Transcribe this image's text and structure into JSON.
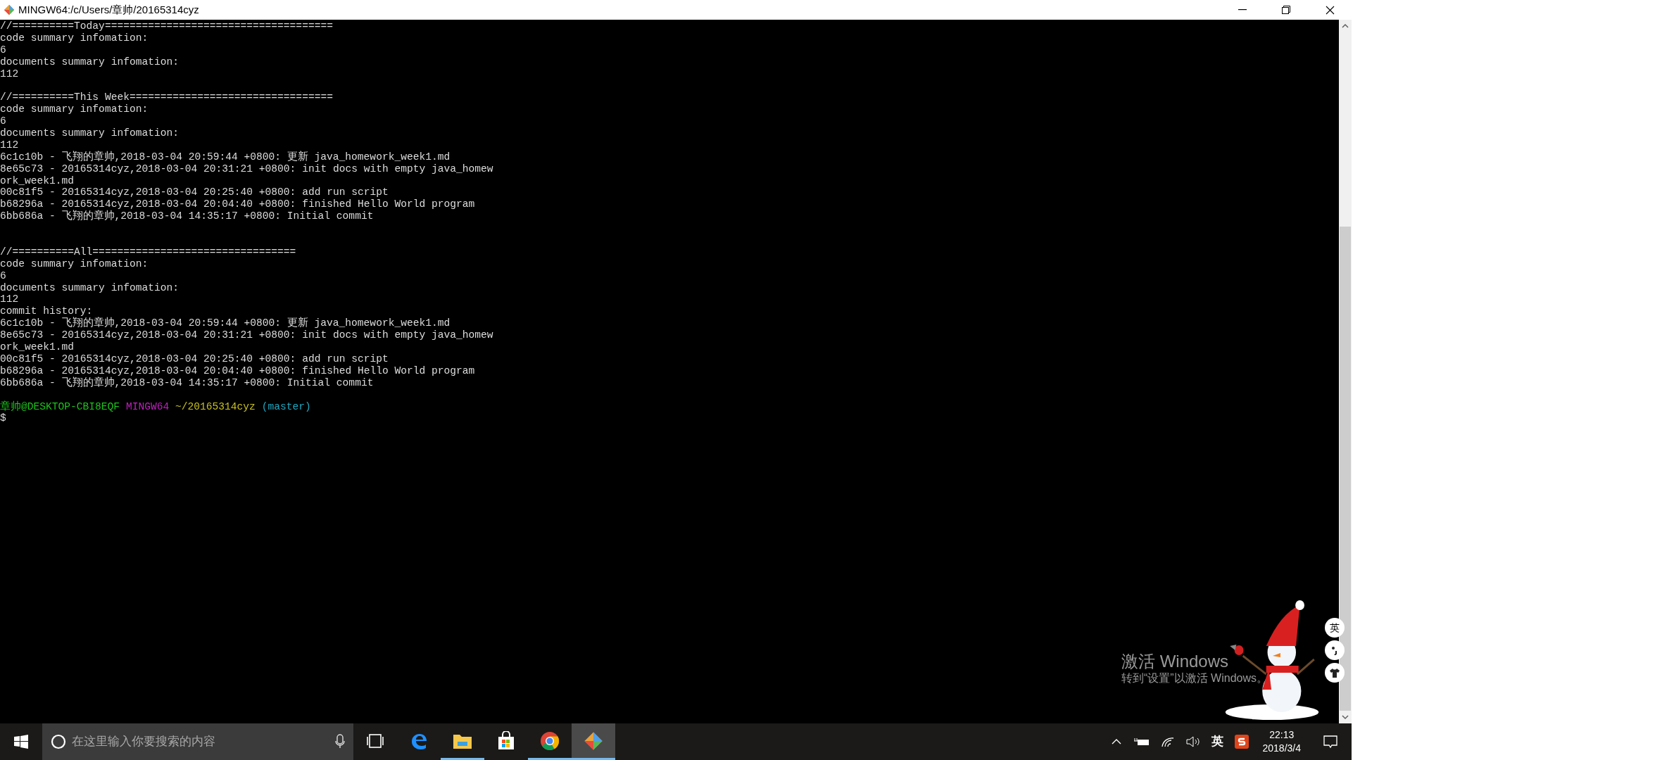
{
  "window": {
    "title": "MINGW64:/c/Users/章帅/20165314cyz"
  },
  "terminal": {
    "lines": [
      {
        "kind": "text",
        "text": "//==========Today====================================="
      },
      {
        "kind": "text",
        "text": "code summary infomation:"
      },
      {
        "kind": "text",
        "text": "6"
      },
      {
        "kind": "text",
        "text": "documents summary infomation:"
      },
      {
        "kind": "text",
        "text": "112"
      },
      {
        "kind": "blank"
      },
      {
        "kind": "text",
        "text": "//==========This Week================================="
      },
      {
        "kind": "text",
        "text": "code summary infomation:"
      },
      {
        "kind": "text",
        "text": "6"
      },
      {
        "kind": "text",
        "text": "documents summary infomation:"
      },
      {
        "kind": "text",
        "text": "112"
      },
      {
        "kind": "text",
        "text": "6c1c10b - 飞翔的章帅,2018-03-04 20:59:44 +0800: 更新 java_homework_week1.md"
      },
      {
        "kind": "text",
        "text": "8e65c73 - 20165314cyz,2018-03-04 20:31:21 +0800: init docs with empty java_homew"
      },
      {
        "kind": "text",
        "text": "ork_week1.md"
      },
      {
        "kind": "text",
        "text": "00c81f5 - 20165314cyz,2018-03-04 20:25:40 +0800: add run script"
      },
      {
        "kind": "text",
        "text": "b68296a - 20165314cyz,2018-03-04 20:04:40 +0800: finished Hello World program"
      },
      {
        "kind": "text",
        "text": "6bb686a - 飞翔的章帅,2018-03-04 14:35:17 +0800: Initial commit"
      },
      {
        "kind": "blank"
      },
      {
        "kind": "blank"
      },
      {
        "kind": "text",
        "text": "//==========All================================="
      },
      {
        "kind": "text",
        "text": "code summary infomation:"
      },
      {
        "kind": "text",
        "text": "6"
      },
      {
        "kind": "text",
        "text": "documents summary infomation:"
      },
      {
        "kind": "text",
        "text": "112"
      },
      {
        "kind": "text",
        "text": "commit history:"
      },
      {
        "kind": "text",
        "text": "6c1c10b - 飞翔的章帅,2018-03-04 20:59:44 +0800: 更新 java_homework_week1.md"
      },
      {
        "kind": "text",
        "text": "8e65c73 - 20165314cyz,2018-03-04 20:31:21 +0800: init docs with empty java_homew"
      },
      {
        "kind": "text",
        "text": "ork_week1.md"
      },
      {
        "kind": "text",
        "text": "00c81f5 - 20165314cyz,2018-03-04 20:25:40 +0800: add run script"
      },
      {
        "kind": "text",
        "text": "b68296a - 20165314cyz,2018-03-04 20:04:40 +0800: finished Hello World program"
      },
      {
        "kind": "text",
        "text": "6bb686a - 飞翔的章帅,2018-03-04 14:35:17 +0800: Initial commit"
      },
      {
        "kind": "blank"
      },
      {
        "kind": "prompt",
        "segments": [
          {
            "text": "章帅@DESKTOP-CBI8EQF",
            "color": "#1cc41c"
          },
          {
            "text": "MINGW64",
            "color": "#c020c0"
          },
          {
            "text": "~/20165314cyz",
            "color": "#c8c020"
          },
          {
            "text": "(master)",
            "color": "#20a8c0"
          }
        ]
      },
      {
        "kind": "text",
        "text": "$"
      }
    ]
  },
  "activation_notice": {
    "title": "激活 Windows",
    "subtitle": "转到“设置”以激活 Windows。"
  },
  "ime_toolbar": {
    "language": "英"
  },
  "taskbar": {
    "search": {
      "placeholder": "在这里输入你要搜索的内容"
    },
    "apps": [
      {
        "kind": "taskview",
        "running": false,
        "selected": false
      },
      {
        "kind": "edge",
        "running": false,
        "selected": false
      },
      {
        "kind": "explorer",
        "running": true,
        "selected": false
      },
      {
        "kind": "store",
        "running": false,
        "selected": false
      },
      {
        "kind": "chrome",
        "running": true,
        "selected": false
      },
      {
        "kind": "git",
        "running": true,
        "selected": true
      }
    ],
    "tray": {
      "input_language": "英",
      "time": "22:13",
      "date": "2018/3/4"
    }
  }
}
